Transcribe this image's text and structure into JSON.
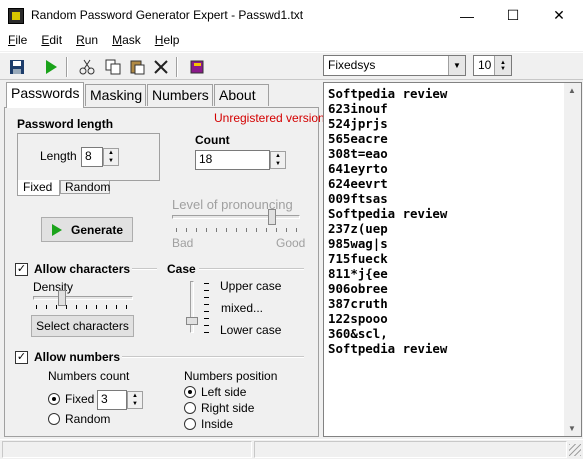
{
  "window": {
    "title": "Random Password Generator Expert - Passwd1.txt",
    "minimize": "—",
    "maximize": "☐",
    "close": "✕"
  },
  "menu": [
    {
      "key": "F",
      "rest": "ile"
    },
    {
      "key": "E",
      "rest": "dit"
    },
    {
      "key": "R",
      "rest": "un"
    },
    {
      "key": "M",
      "rest": "ask"
    },
    {
      "key": "H",
      "rest": "elp"
    }
  ],
  "toolbar": {
    "font_name": "Fixedsys",
    "font_size": "10"
  },
  "tabs": [
    "Passwords",
    "Masking",
    "Numbers",
    "About"
  ],
  "password_length": {
    "heading": "Password length",
    "unregistered": "Unregistered version",
    "length_label": "Length",
    "length_value": "8",
    "mode_fixed": "Fixed",
    "mode_random": "Random",
    "count_label": "Count",
    "count_value": "18"
  },
  "generate_label": "Generate",
  "pronouncing": {
    "label": "Level of pronouncing",
    "bad": "Bad",
    "good": "Good"
  },
  "allow_characters": {
    "label": "Allow characters",
    "checked": "✓",
    "density_label": "Density",
    "select_button": "Select characters"
  },
  "case": {
    "label": "Case",
    "upper": "Upper case",
    "mixed": "mixed...",
    "lower": "Lower case"
  },
  "allow_numbers": {
    "label": "Allow numbers",
    "checked": "✓",
    "count_label": "Numbers count",
    "fixed": "Fixed",
    "fixed_value": "3",
    "random": "Random",
    "position_label": "Numbers position",
    "left": "Left side",
    "right": "Right side",
    "inside": "Inside"
  },
  "output_lines": [
    "Softpedia review",
    "623inouf",
    "524jprjs",
    "565eacre",
    "308t=eao",
    "641eyrto",
    "624eevrt",
    "009ftsas",
    "Softpedia review",
    "237z(uep",
    "985wag|s",
    "715fueck",
    "811*j{ee",
    "906obree",
    "387cruth",
    "122spooo",
    "360&scl,",
    "Softpedia review"
  ]
}
